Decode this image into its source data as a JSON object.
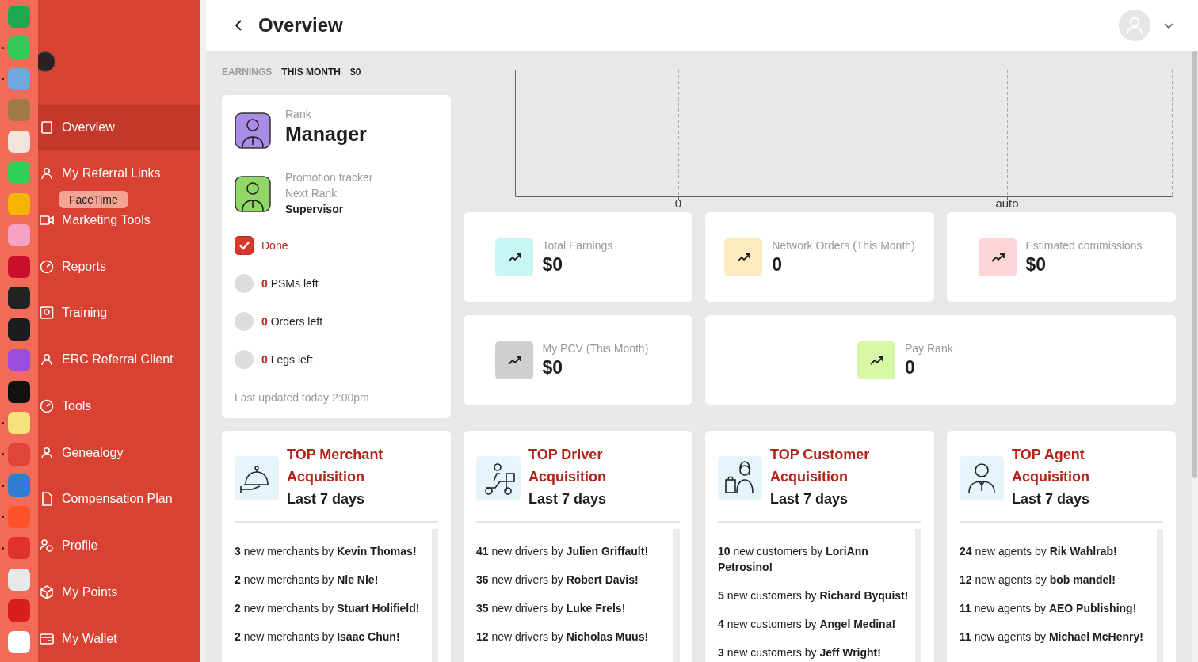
{
  "dock": {
    "apps": [
      {
        "running": false
      },
      {
        "running": true
      },
      {
        "running": true
      },
      {
        "running": false
      },
      {
        "running": false
      },
      {
        "running": false
      },
      {
        "running": false
      },
      {
        "running": false
      },
      {
        "running": false
      },
      {
        "running": false
      },
      {
        "running": false
      },
      {
        "running": false
      },
      {
        "running": false
      },
      {
        "running": true
      },
      {
        "running": true
      },
      {
        "running": true
      },
      {
        "running": true
      },
      {
        "running": true
      },
      {
        "running": false
      },
      {
        "running": false
      },
      {
        "running": false
      }
    ],
    "tooltip": "FaceTime"
  },
  "sidebar": {
    "items": [
      {
        "label": "Overview",
        "selected": true
      },
      {
        "label": "My Referral Links",
        "selected": false
      },
      {
        "label": "Marketing Tools",
        "selected": false
      },
      {
        "label": "Reports",
        "selected": false
      },
      {
        "label": "Training",
        "selected": false
      },
      {
        "label": "ERC Referral Client",
        "selected": false
      },
      {
        "label": "Tools",
        "selected": false
      },
      {
        "label": "Genealogy",
        "selected": false
      },
      {
        "label": "Compensation Plan",
        "selected": false
      },
      {
        "label": "Profile",
        "selected": false
      },
      {
        "label": "My Points",
        "selected": false
      },
      {
        "label": "My Wallet",
        "selected": false
      }
    ]
  },
  "header": {
    "title": "Overview"
  },
  "earnings": {
    "label": "EARNINGS",
    "period": "THIS MONTH",
    "amount": "$0"
  },
  "rank_card": {
    "rank_label": "Rank",
    "rank": "Manager",
    "tracker_label": "Promotion tracker",
    "next_rank_label": "Next Rank",
    "next_rank": "Supervisor",
    "tracker": [
      {
        "label": "Done",
        "checked": true
      },
      {
        "label": "**0** PSMs left",
        "checked": false
      },
      {
        "label": "**0** Orders left",
        "checked": false
      },
      {
        "label": "**0** Legs left",
        "checked": false
      }
    ],
    "updated": "Last updated today 2:00pm"
  },
  "chart": {
    "tick_labels": [
      "0",
      "auto"
    ]
  },
  "stats": [
    {
      "label": "Total Earnings",
      "value": "$0",
      "color": "#c8f7f3",
      "wide": false
    },
    {
      "label": "Network Orders (This Month)",
      "value": "0",
      "color": "#fdebbd",
      "wide": false
    },
    {
      "label": "Estimated commissions",
      "value": "$0",
      "color": "#fdd5d8",
      "wide": false
    },
    {
      "label": "My PCV (This Month)",
      "value": "$0",
      "color": "#cfcfcf",
      "wide": false
    },
    {
      "label": "Pay Rank",
      "value": "0",
      "color": "#d6f7a4",
      "wide": true
    }
  ],
  "top_lists": [
    {
      "kind": "merchant",
      "title": "TOP Merchant Acquisition",
      "subtitle": "Last 7 days",
      "entries": [
        "**3** new merchants by **Kevin Thomas!**",
        "**2** new merchants by **Nle Nle!**",
        "**2** new merchants by **Stuart Holifield!**",
        "**2** new merchants by **Isaac Chun!**"
      ]
    },
    {
      "kind": "driver",
      "title": "TOP Driver Acquisition",
      "subtitle": "Last 7 days",
      "entries": [
        "**41** new drivers by **Julien Griffault!**",
        "**36** new drivers by **Robert Davis!**",
        "**35** new drivers by **Luke Frels!**",
        "**12** new drivers by **Nicholas Muus!**"
      ]
    },
    {
      "kind": "customer",
      "title": "TOP Customer Acquisition",
      "subtitle": "Last 7 days",
      "entries": [
        "**10** new customers by **LoriAnn Petrosino!**",
        "**5** new customers by **Richard Byquist!**",
        "**4** new customers by **Angel Medina!**",
        "**3** new customers by **Jeff Wright!**"
      ]
    },
    {
      "kind": "agent",
      "title": "TOP Agent Acquisition",
      "subtitle": "Last 7 days",
      "entries": [
        "**24** new agents by **Rik Wahlrab!**",
        "**12** new agents by **bob mandel!**",
        "**11** new agents by **AEO Publishing!**",
        "**11** new agents by **Michael McHenry!**"
      ]
    }
  ]
}
